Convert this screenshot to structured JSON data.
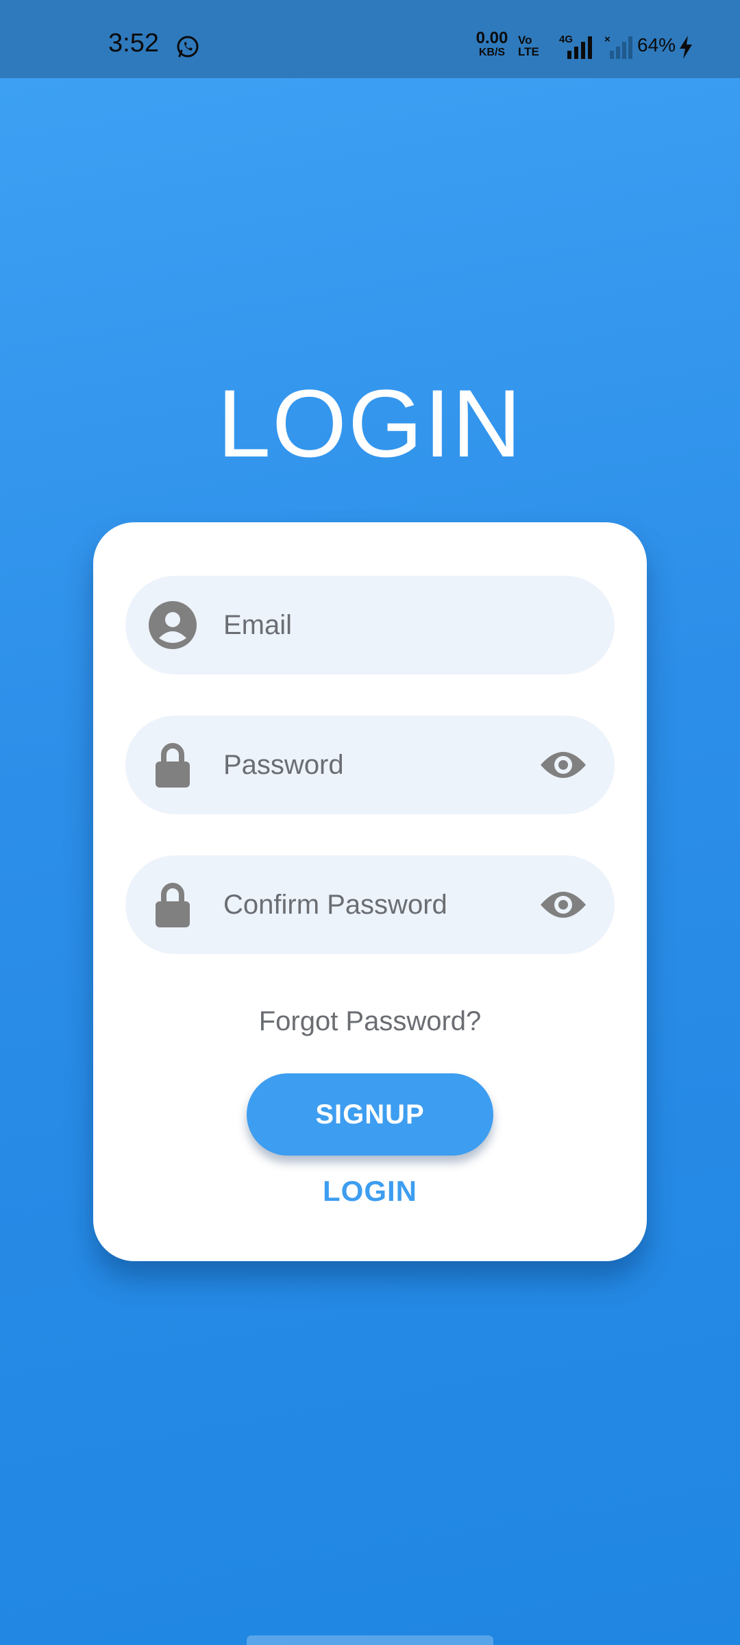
{
  "status_bar": {
    "time": "3:52",
    "net_speed_value": "0.00",
    "net_speed_unit": "KB/S",
    "volte_top": "Vo",
    "volte_bottom": "LTE",
    "network_type": "4G",
    "battery": "64%",
    "icons": [
      "whatsapp-icon",
      "volte-icon",
      "signal-4g-icon",
      "signal-no-service-icon",
      "charging-icon"
    ]
  },
  "page": {
    "title": "LOGIN"
  },
  "form": {
    "email_placeholder": "Email",
    "password_placeholder": "Password",
    "confirm_password_placeholder": "Confirm Password",
    "forgot_password": "Forgot Password?",
    "signup_label": "SIGNUP",
    "login_label": "LOGIN"
  },
  "colors": {
    "background_top": "#3fa2f4",
    "background_bottom": "#1f86e2",
    "status_bar": "#2f7abd",
    "card": "#ffffff",
    "field_background": "#edf3fa",
    "icon_gray": "#808080",
    "accent": "#3d9df0"
  }
}
